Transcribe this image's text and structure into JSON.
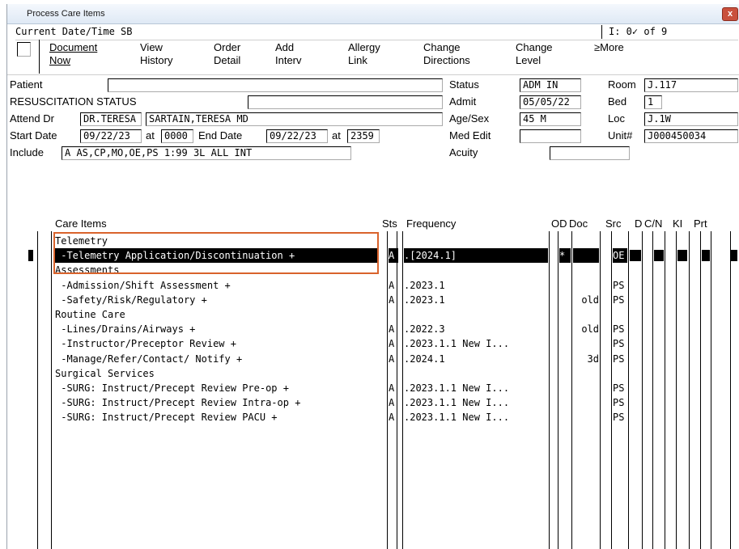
{
  "window": {
    "title": "Process Care Items",
    "close_label": "x"
  },
  "header": {
    "current_datetime": "Current Date/Time SB",
    "counter": "I: 0✓ of 9"
  },
  "menu": [
    {
      "line1": "Document",
      "line2": "Now"
    },
    {
      "line1": "View",
      "line2": "History"
    },
    {
      "line1": "Order",
      "line2": "Detail"
    },
    {
      "line1": "Add",
      "line2": "Interv"
    },
    {
      "line1": "Allergy",
      "line2": "Link"
    },
    {
      "line1": "Change",
      "line2": "Directions"
    },
    {
      "line1": "Change",
      "line2": "Level"
    },
    {
      "line1": "≥More",
      "line2": ""
    }
  ],
  "patient": {
    "patient_label": "Patient",
    "patient_value": "",
    "resus_label": "RESUSCITATION STATUS",
    "resus_value": "",
    "attend_label": "Attend Dr",
    "attend_id": "DR.TERESA",
    "attend_name": "SARTAIN,TERESA MD",
    "start_label": "Start Date",
    "start_date": "09/22/23",
    "at1": "at",
    "start_time": "0000",
    "end_label": "End Date",
    "end_date": "09/22/23",
    "at2": "at",
    "end_time": "2359",
    "include_label": "Include",
    "include_value": "A AS,CP,MO,OE,PS 1:99 3L ALL INT",
    "status_label": "Status",
    "status_value": "ADM IN",
    "admit_label": "Admit",
    "admit_value": "05/05/22",
    "agesex_label": "Age/Sex",
    "agesex_value": "45 M",
    "mededit_label": "Med Edit",
    "mededit_value": "",
    "acuity_label": "Acuity",
    "acuity_value": "",
    "room_label": "Room",
    "room_value": "J.117",
    "bed_label": "Bed",
    "bed_value": "1",
    "loc_label": "Loc",
    "loc_value": "J.1W",
    "unit_label": "Unit#",
    "unit_value": "J000450034"
  },
  "columns": {
    "care_items": "Care Items",
    "sts": "Sts",
    "frequency": "Frequency",
    "od": "OD",
    "doc": "Doc",
    "src": "Src",
    "d": "D",
    "cn": "C/N",
    "ki": "KI",
    "prt": "Prt"
  },
  "rows": [
    {
      "item": "Telemetry",
      "sts": "",
      "freq": "",
      "od": "",
      "doc": "",
      "src": "",
      "selected": false
    },
    {
      "item": " -Telemetry Application/Discontinuation +",
      "sts": "A",
      "freq": ".[2024.1]",
      "od": "*",
      "doc": "",
      "src": "OE",
      "selected": true
    },
    {
      "item": "Assessments",
      "sts": "",
      "freq": "",
      "od": "",
      "doc": "",
      "src": "",
      "selected": false
    },
    {
      "item": " -Admission/Shift Assessment +",
      "sts": "A",
      "freq": ".2023.1",
      "od": "",
      "doc": "",
      "src": "PS",
      "selected": false
    },
    {
      "item": " -Safety/Risk/Regulatory +",
      "sts": "A",
      "freq": ".2023.1",
      "od": "",
      "doc": "old",
      "src": "PS",
      "selected": false
    },
    {
      "item": "Routine Care",
      "sts": "",
      "freq": "",
      "od": "",
      "doc": "",
      "src": "",
      "selected": false
    },
    {
      "item": " -Lines/Drains/Airways +",
      "sts": "A",
      "freq": ".2022.3",
      "od": "",
      "doc": "old",
      "src": "PS",
      "selected": false
    },
    {
      "item": " -Instructor/Preceptor Review +",
      "sts": "A",
      "freq": ".2023.1.1 New I...",
      "od": "",
      "doc": "",
      "src": "PS",
      "selected": false
    },
    {
      "item": " -Manage/Refer/Contact/ Notify +",
      "sts": "A",
      "freq": ".2024.1",
      "od": "",
      "doc": "3d",
      "src": "PS",
      "selected": false
    },
    {
      "item": "Surgical Services",
      "sts": "",
      "freq": "",
      "od": "",
      "doc": "",
      "src": "",
      "selected": false
    },
    {
      "item": " -SURG: Instruct/Precept Review Pre-op +",
      "sts": "A",
      "freq": ".2023.1.1 New I...",
      "od": "",
      "doc": "",
      "src": "PS",
      "selected": false
    },
    {
      "item": " -SURG: Instruct/Precept Review Intra-op +",
      "sts": "A",
      "freq": ".2023.1.1 New I...",
      "od": "",
      "doc": "",
      "src": "PS",
      "selected": false
    },
    {
      "item": " -SURG: Instruct/Precept Review PACU +",
      "sts": "A",
      "freq": ".2023.1.1 New I...",
      "od": "",
      "doc": "",
      "src": "PS",
      "selected": false
    }
  ],
  "colors": {
    "highlight_box": "#d9632c",
    "selection": "#000000"
  }
}
